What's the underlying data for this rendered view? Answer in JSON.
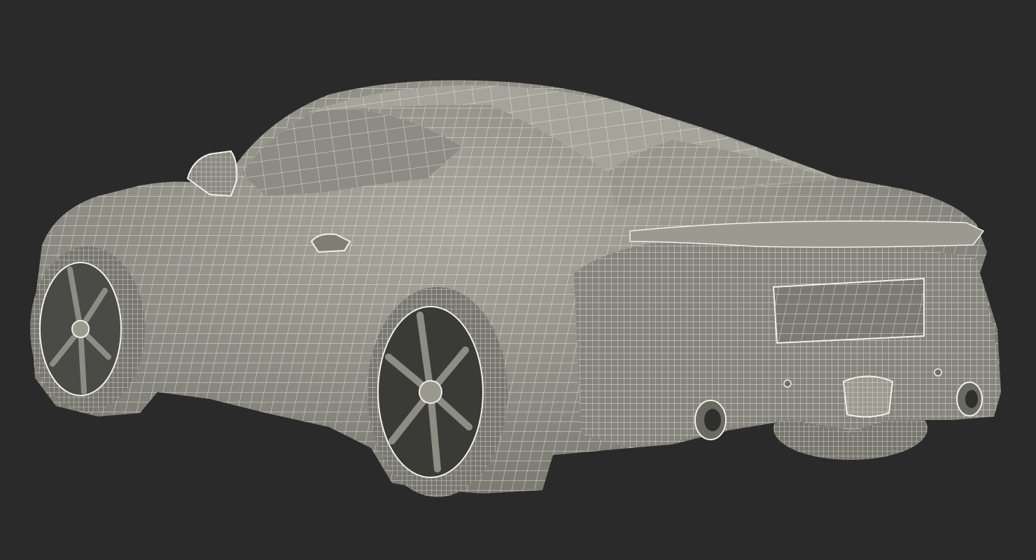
{
  "scene": {
    "subject": "sports-car-wireframe",
    "view": "rear-three-quarter",
    "colors": {
      "background": "#2a2a2a",
      "body_shade": "#8f8f86",
      "body_light": "#a9a99f",
      "body_dark": "#6f6f68",
      "wire": "#f2f1e6",
      "tire": "#77776f",
      "rim_dark": "#3a3a37"
    }
  }
}
